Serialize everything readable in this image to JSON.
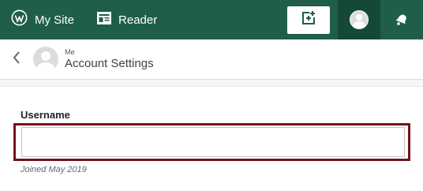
{
  "masterbar": {
    "my_site_label": "My Site",
    "reader_label": "Reader",
    "bg_color": "#1e5e4b",
    "icons": {
      "my_site": "wordpress-icon",
      "reader": "reader-icon",
      "write": "write-post-icon",
      "me": "avatar",
      "notifications": "bell-icon"
    }
  },
  "header": {
    "subtitle": "Me",
    "title": "Account Settings"
  },
  "form": {
    "username_label": "Username",
    "username_value": "",
    "joined_text": "Joined May 2019",
    "highlight_color": "#74121d"
  }
}
